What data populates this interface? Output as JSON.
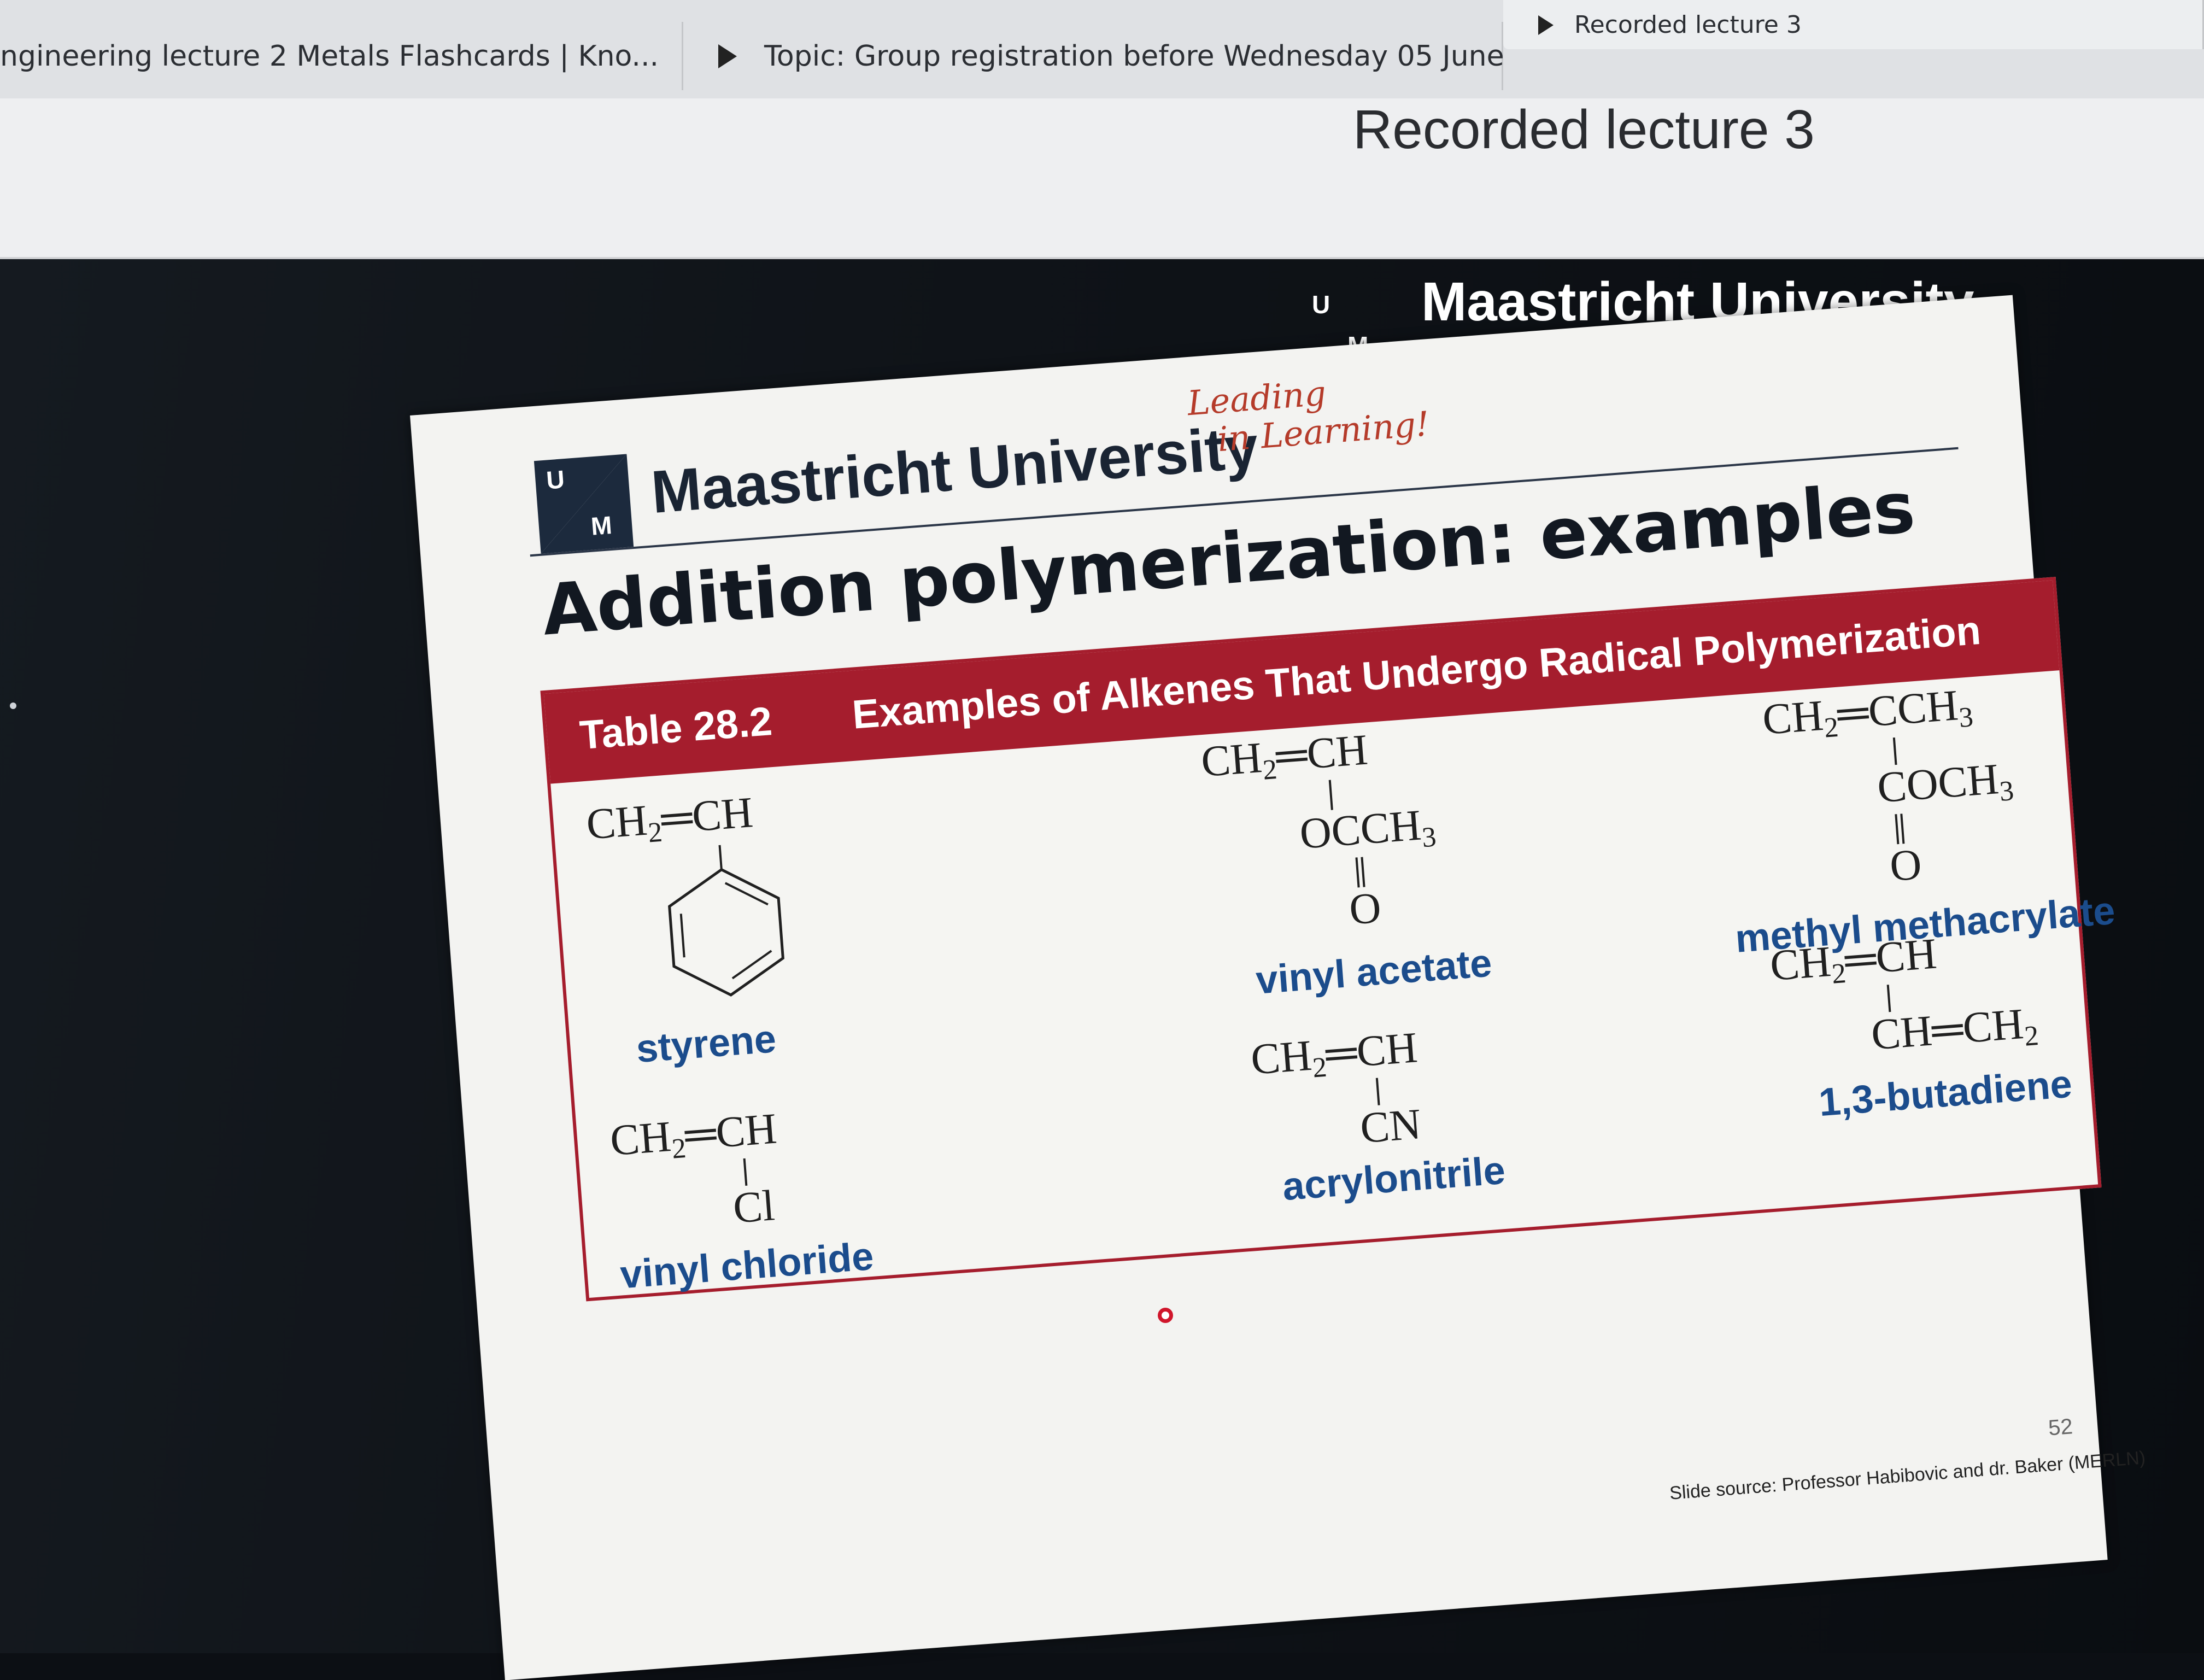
{
  "tabs": [
    {
      "title": "ngineering lecture 2 Metals Flashcards | Kno...",
      "icon": "flashcard-icon"
    },
    {
      "title": "Topic: Group registration before Wednesday 05 June",
      "icon": "forum-play-icon"
    },
    {
      "title": "Recorded lecture 3",
      "icon": "video-play-icon"
    }
  ],
  "page": {
    "title": "Recorded lecture 3"
  },
  "video_overlay": {
    "logo_u": "U",
    "logo_m": "M",
    "university": "Maastricht University"
  },
  "slide": {
    "logo_u": "U",
    "logo_m": "M",
    "university": "Maastricht University",
    "tagline_1": "Leading",
    "tagline_2": "in Learning!",
    "title": "Addition polymerization: examples",
    "table_number": "Table 28.2",
    "table_caption": "Examples of Alkenes That Undergo Radical Polymerization",
    "compounds": [
      {
        "name": "styrene",
        "formula": "CH2=CH"
      },
      {
        "name": "vinyl acetate",
        "formula": "CH2=CH",
        "substituent": "OCCH3",
        "extra": "O"
      },
      {
        "name": "methyl methacrylate",
        "formula": "CH2=CCH3",
        "substituent": "COCH3",
        "extra": "O"
      },
      {
        "name": "vinyl chloride",
        "formula": "CH2=CH",
        "substituent": "Cl"
      },
      {
        "name": "acrylonitrile",
        "formula": "CH2=CH",
        "substituent": "CN"
      },
      {
        "name": "1,3-butadiene",
        "formula": "CH2=CH",
        "substituent": "CH=CH2"
      }
    ],
    "page_number": "52",
    "source": "Slide source: Professor Habibovic and dr. Baker (MERLN)"
  },
  "colors": {
    "accent_red": "#a51d2d",
    "compound_blue": "#1b4c8c",
    "tagline_red": "#b53b2a"
  }
}
